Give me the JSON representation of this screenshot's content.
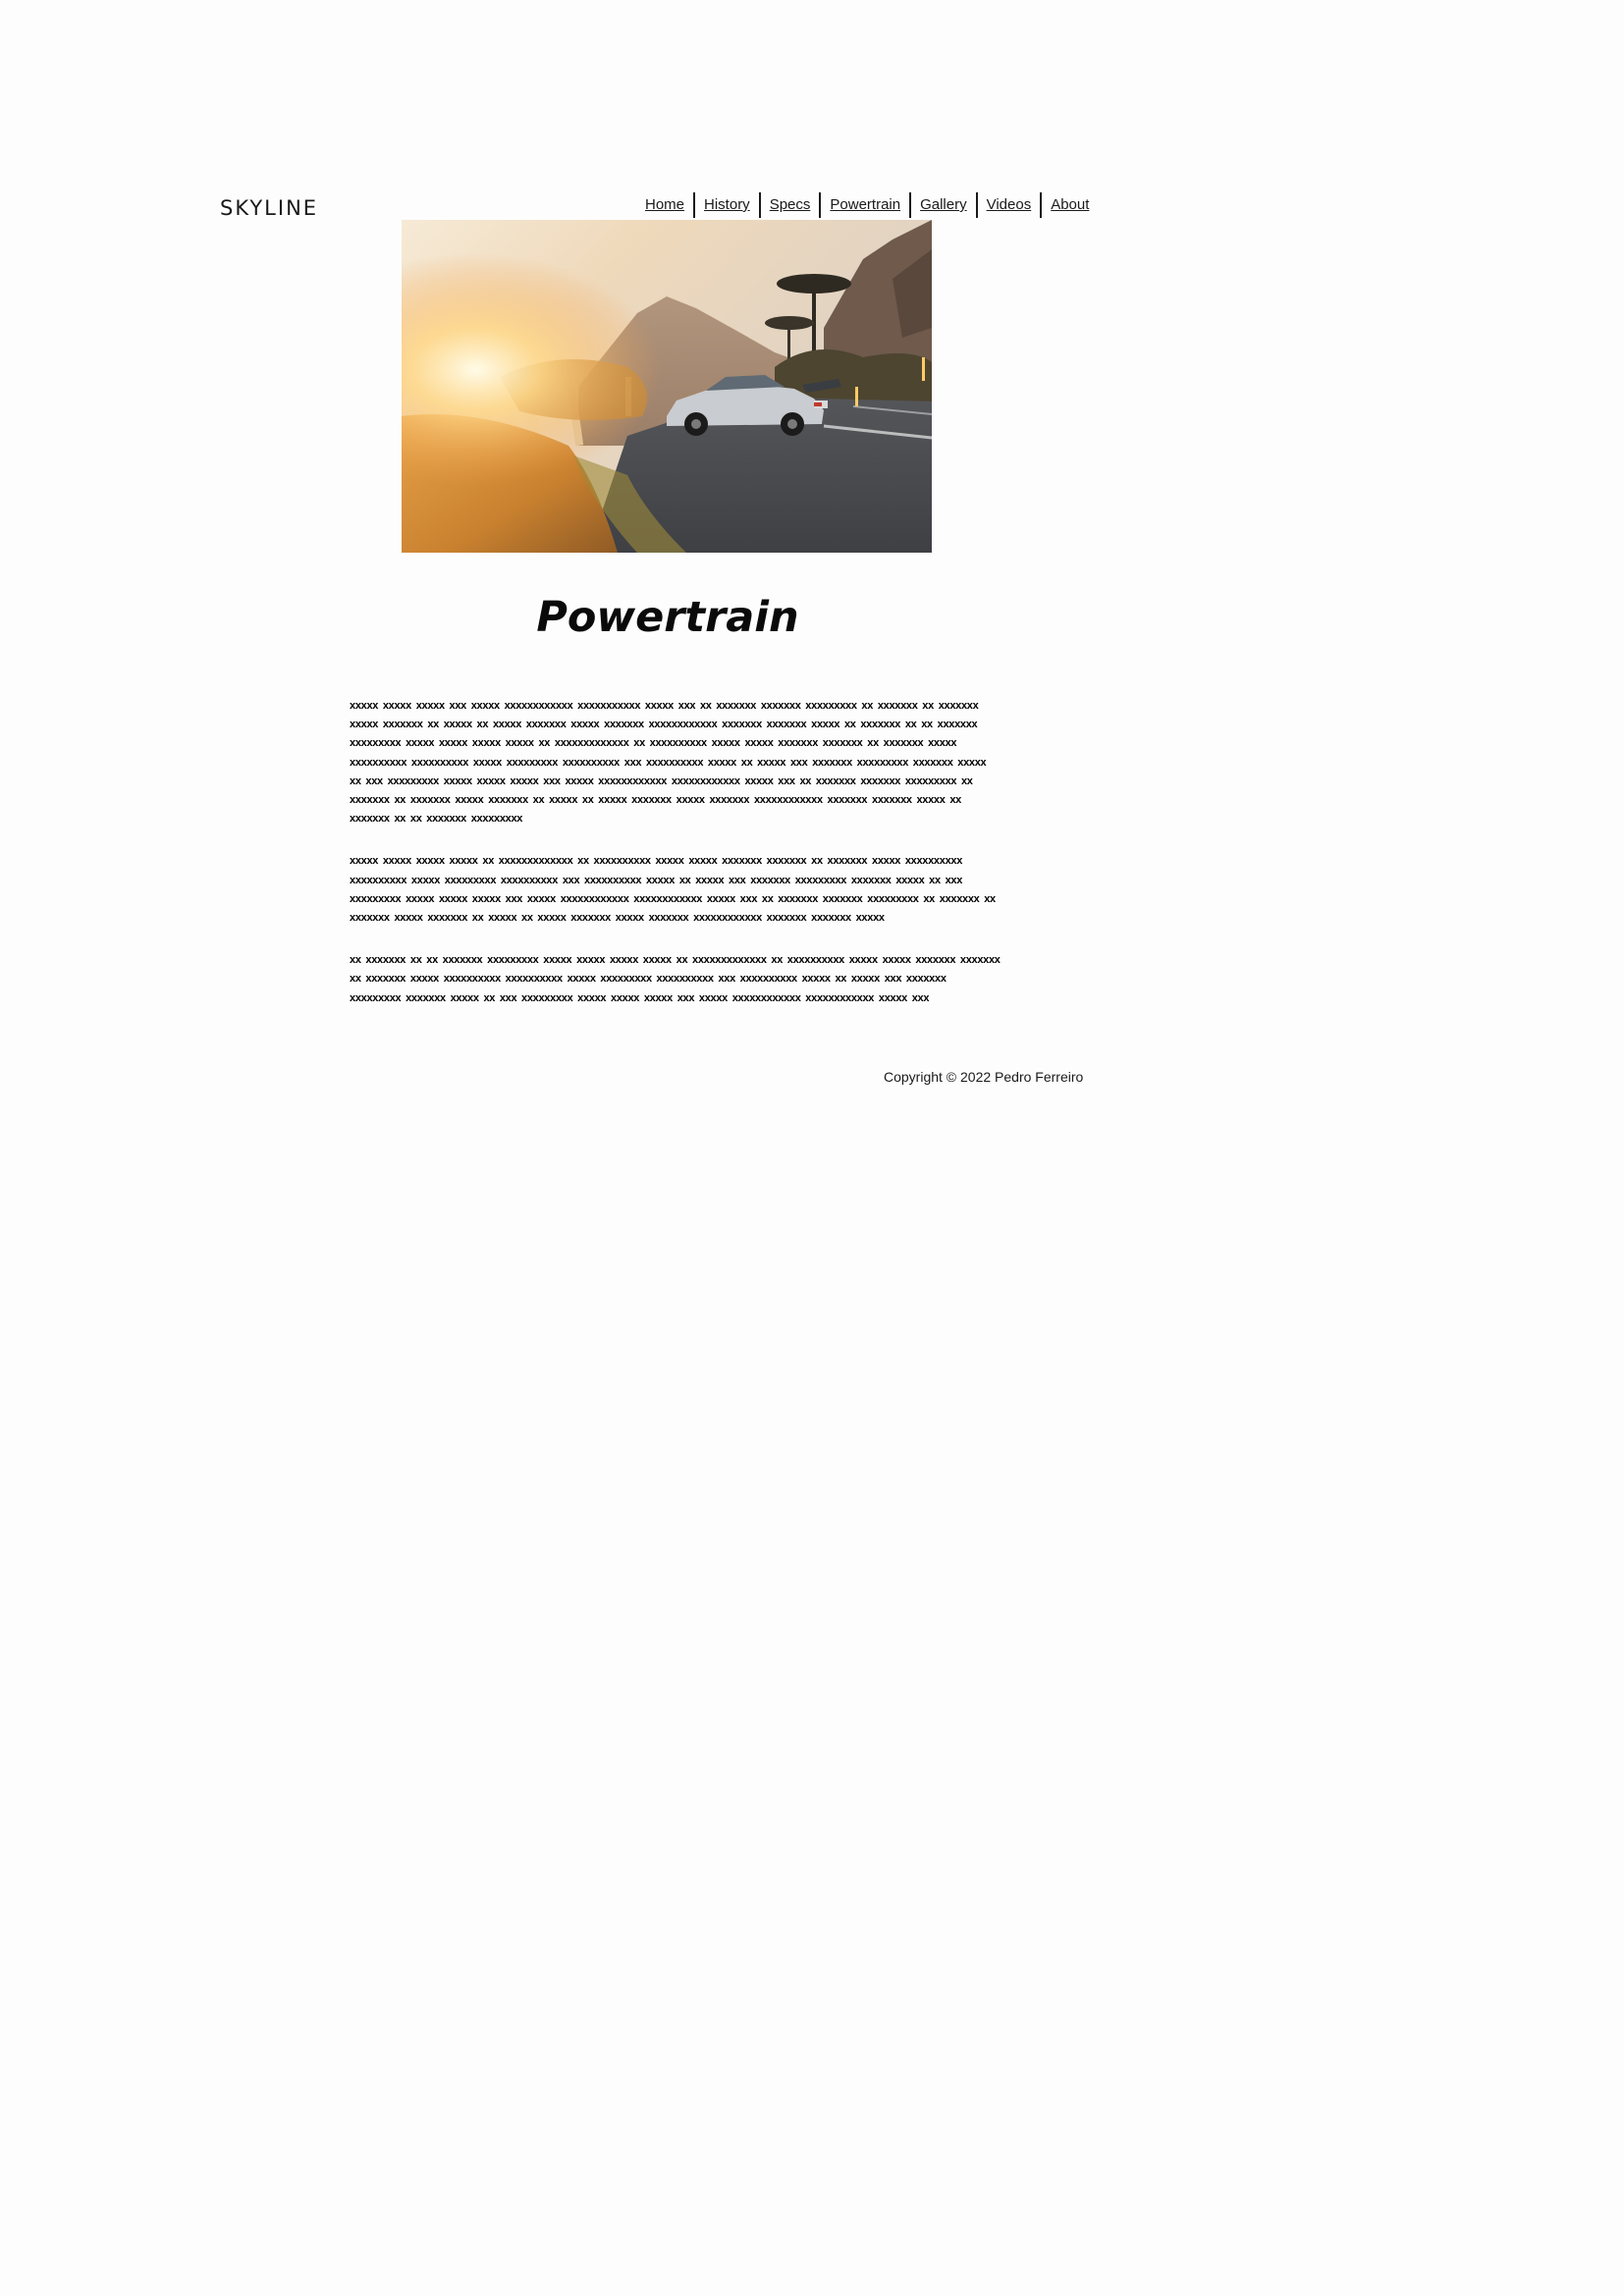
{
  "site": {
    "logo": "SKYLINE"
  },
  "nav": {
    "items": [
      {
        "label": "Home"
      },
      {
        "label": "History"
      },
      {
        "label": "Specs"
      },
      {
        "label": "Powertrain"
      },
      {
        "label": "Gallery"
      },
      {
        "label": "Videos"
      },
      {
        "label": "About"
      }
    ]
  },
  "hero": {
    "image": "sunset-road-sports-car-photo"
  },
  "main": {
    "title": "Powertrain",
    "paragraphs": [
      "xxxxx xxxxx xxxxx xxx xxxxx xxxxxxxxxxxx xxxxxxxxxxx xxxxx xxx xx xxxxxxx xxxxxxx xxxxxxxxx xx xxxxxxx xx xxxxxxx xxxxx xxxxxxx xx xxxxx xx xxxxx xxxxxxx xxxxx xxxxxxx xxxxxxxxxxxx xxxxxxx xxxxxxx xxxxx xx xxxxxxx xx xx xxxxxxx xxxxxxxxx xxxxx xxxxx xxxxx xxxxx xx xxxxxxxxxxxxx xx xxxxxxxxxx xxxxx xxxxx xxxxxxx xxxxxxx xx xxxxxxx xxxxx xxxxxxxxxx xxxxxxxxxx xxxxx xxxxxxxxx xxxxxxxxxx xxx xxxxxxxxxx xxxxx xx xxxxx xxx xxxxxxx xxxxxxxxx xxxxxxx xxxxx xx xxx xxxxxxxxx xxxxx xxxxx xxxxx xxx xxxxx xxxxxxxxxxxx xxxxxxxxxxxx xxxxx xxx xx xxxxxxx xxxxxxx xxxxxxxxx xx xxxxxxx xx xxxxxxx xxxxx xxxxxxx xx xxxxx xx xxxxx xxxxxxx xxxxx xxxxxxx xxxxxxxxxxxx xxxxxxx xxxxxxx xxxxx xx xxxxxxx xx xx xxxxxxx xxxxxxxxx",
      "xxxxx xxxxx xxxxx xxxxx xx xxxxxxxxxxxxx xx xxxxxxxxxx xxxxx xxxxx xxxxxxx xxxxxxx xx xxxxxxx xxxxx xxxxxxxxxx xxxxxxxxxx xxxxx xxxxxxxxx xxxxxxxxxx xxx xxxxxxxxxx xxxxx xx xxxxx xxx xxxxxxx xxxxxxxxx xxxxxxx xxxxx xx xxx xxxxxxxxx xxxxx xxxxx xxxxx xxx xxxxx xxxxxxxxxxxx xxxxxxxxxxxx xxxxx xxx xx xxxxxxx xxxxxxx xxxxxxxxx xx xxxxxxx xx xxxxxxx xxxxx xxxxxxx xx xxxxx xx xxxxx xxxxxxx xxxxx xxxxxxx xxxxxxxxxxxx xxxxxxx xxxxxxx xxxxx",
      "xx xxxxxxx xx xx xxxxxxx xxxxxxxxx xxxxx xxxxx xxxxx xxxxx xx xxxxxxxxxxxxx xx xxxxxxxxxx xxxxx xxxxx xxxxxxx xxxxxxx xx xxxxxxx xxxxx xxxxxxxxxx xxxxxxxxxx xxxxx xxxxxxxxx xxxxxxxxxx xxx xxxxxxxxxx xxxxx xx xxxxx xxx xxxxxxx xxxxxxxxx xxxxxxx xxxxx xx xxx xxxxxxxxx xxxxx xxxxx xxxxx xxx xxxxx xxxxxxxxxxxx xxxxxxxxxxxx xxxxx xxx"
    ]
  },
  "footer": {
    "copyright": "Copyright © 2022 Pedro Ferreiro"
  }
}
